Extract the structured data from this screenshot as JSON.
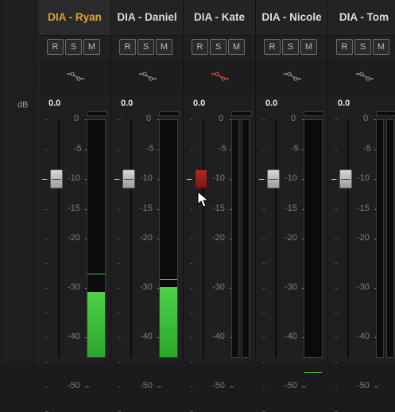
{
  "left_column": {
    "db_label": "dB"
  },
  "scale_labels": [
    "0",
    "-5",
    "-10",
    "-15",
    "-20",
    "-30",
    "-40",
    "-50"
  ],
  "buttons": {
    "r": "R",
    "s": "S",
    "m": "M"
  },
  "colors": {
    "selected_name": "#e2a42a",
    "active_fader": "#b02a22",
    "eq_active": "#e0453a",
    "eq_inactive": "#8c8c8c",
    "meter_green": "#3fcc3a"
  },
  "channels": [
    {
      "name": "DIA - Ryan",
      "selected": true,
      "db_value": "0.0",
      "fader_active": false,
      "eq_active": false,
      "meter_level_db": -31,
      "meter_peak_db": -27,
      "meter_display": "single"
    },
    {
      "name": "DIA - Daniel",
      "selected": false,
      "db_value": "0.0",
      "fader_active": false,
      "eq_active": false,
      "meter_level_db": -30,
      "meter_peak_db": -28,
      "meter_display": "single"
    },
    {
      "name": "DIA - Kate",
      "selected": false,
      "db_value": "0.0",
      "fader_active": true,
      "eq_active": true,
      "meter_level_db": null,
      "meter_peak_db": null,
      "meter_display": "dual"
    },
    {
      "name": "DIA - Nicole",
      "selected": false,
      "db_value": "0.0",
      "fader_active": false,
      "eq_active": false,
      "meter_level_db": -47,
      "meter_peak_db": -47,
      "meter_display": "single"
    },
    {
      "name": "DIA - Tom",
      "selected": false,
      "db_value": "0.0",
      "fader_active": false,
      "eq_active": false,
      "meter_level_db": null,
      "meter_peak_db": null,
      "meter_display": "dual"
    }
  ]
}
